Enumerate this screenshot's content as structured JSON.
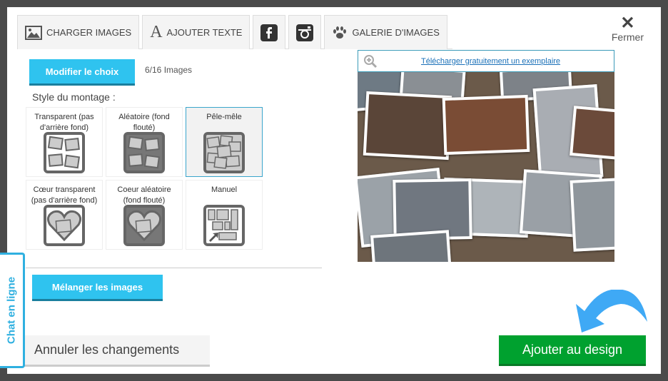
{
  "tabs": [
    {
      "label": "CHARGER IMAGES",
      "icon": "image-icon"
    },
    {
      "label": "AJOUTER TEXTE",
      "icon": "text-icon"
    },
    {
      "label": "",
      "icon": "facebook-icon"
    },
    {
      "label": "",
      "icon": "instagram-icon"
    },
    {
      "label": "GALERIE D'IMAGES",
      "icon": "paw-icon"
    }
  ],
  "close_label": "Fermer",
  "modify_button": "Modifier le choix",
  "image_count": "6/16 Images",
  "style_label": "Style du montage :",
  "styles": [
    {
      "label": "Transparent (pas d'arrière fond)",
      "selected": false
    },
    {
      "label": "Aléatoire (fond flouté)",
      "selected": false
    },
    {
      "label": "Pêle-mêle",
      "selected": true
    },
    {
      "label": "Cœur transparent (pas d'arrière fond)",
      "selected": false
    },
    {
      "label": "Coeur aléatoire (fond flouté)",
      "selected": false
    },
    {
      "label": "Manuel",
      "selected": false
    }
  ],
  "shuffle_button": "Mélanger les images",
  "download_link": "Télécharger gratuitement un exemplaire",
  "cancel_button": "Annuler les changements",
  "add_button": "Ajouter au design",
  "chat_label": "Chat en ligne",
  "colors": {
    "accent": "#2fc3ef",
    "primary": "#00a12f",
    "arrow": "#3fa9f5"
  }
}
